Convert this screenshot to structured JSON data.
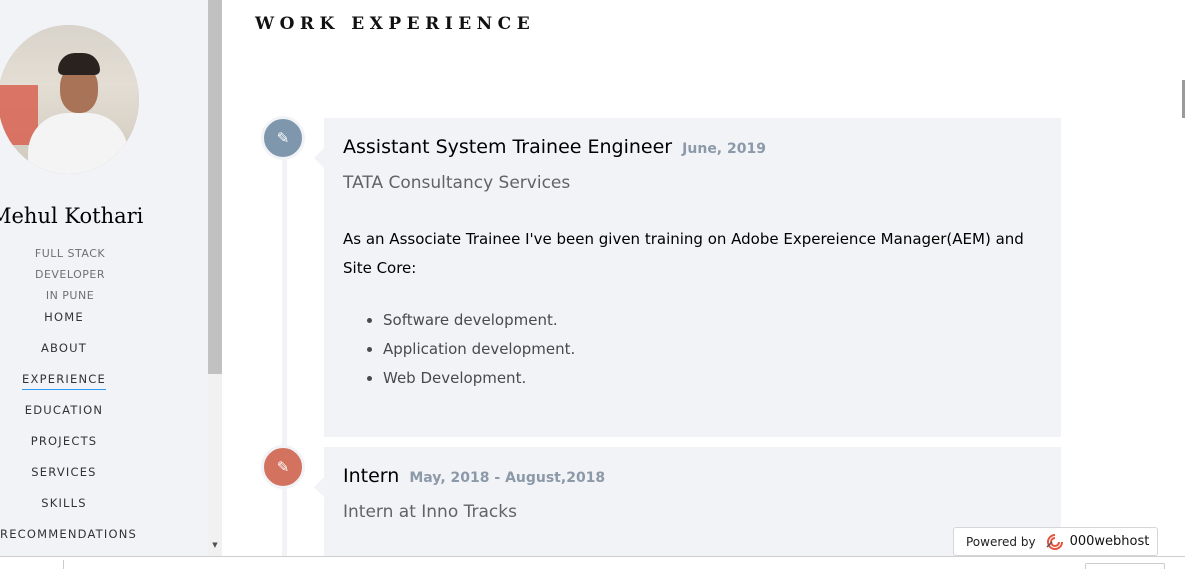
{
  "sidebar": {
    "name": "Mehul Kothari",
    "role_line1": "FULL STACK DEVELOPER",
    "role_line2": "IN PUNE",
    "menu": [
      "HOME",
      "ABOUT",
      "EXPERIENCE",
      "EDUCATION",
      "PROJECTS",
      "SERVICES",
      "SKILLS",
      "RECOMMENDATIONS"
    ],
    "active_item": "EXPERIENCE"
  },
  "section": {
    "heading": "WORK EXPERIENCE"
  },
  "experience": [
    {
      "icon": "pencil-icon",
      "title": "Assistant System Trainee Engineer",
      "date": "June, 2019",
      "company": "TATA Consultancy Services",
      "description": "As an Associate Trainee I've been given training on Adobe Expereience Manager(AEM) and Site Core:",
      "bullets": [
        "Software development.",
        "Application development.",
        "Web Development."
      ]
    },
    {
      "icon": "pencil-icon",
      "title": "Intern",
      "date": "May, 2018 - August,2018",
      "company": "Intern at Inno Tracks"
    }
  ],
  "badge": {
    "label": "Powered by",
    "brand": "000webhost"
  },
  "colors": {
    "accent_blue": "#7e97ad",
    "accent_red": "#d2725f",
    "panel_bg": "#f2f3f7",
    "date_color": "#8c99a8",
    "active_underline": "#2c98f0"
  }
}
